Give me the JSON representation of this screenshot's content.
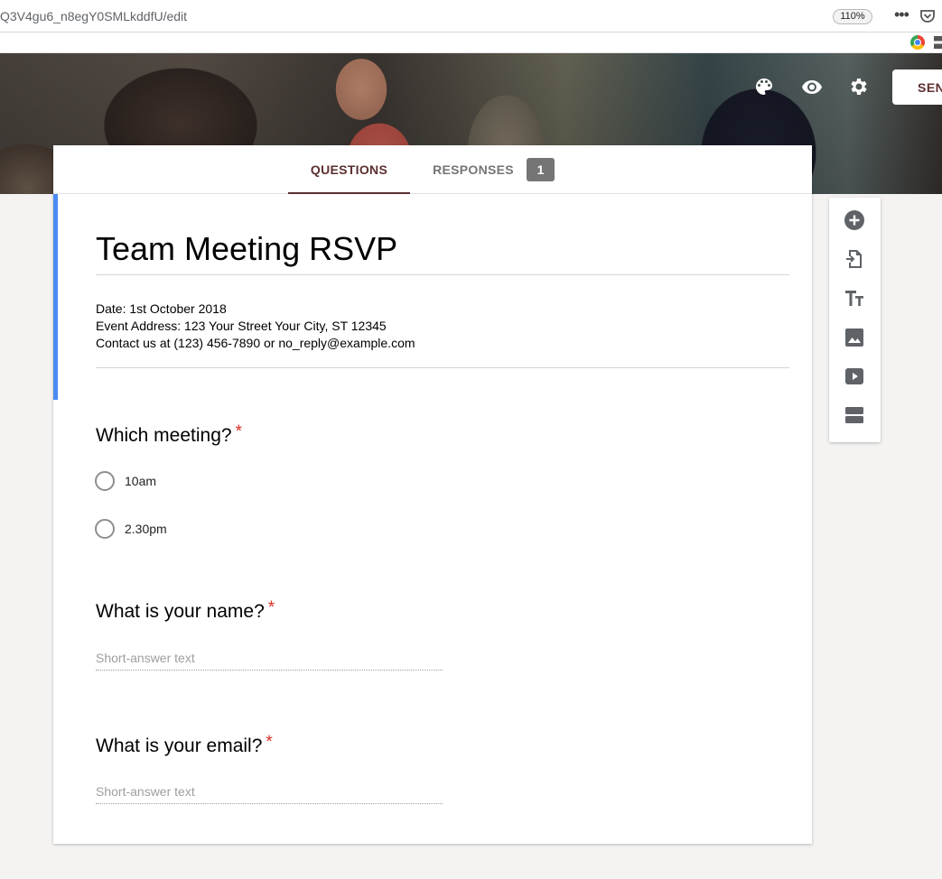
{
  "browser": {
    "url": "Q3V4gu6_n8egY0SMLkddfU/edit",
    "zoom": "110%"
  },
  "header": {
    "send_label": "SEN",
    "icons": [
      "palette-icon",
      "preview-eye-icon",
      "settings-gear-icon"
    ]
  },
  "tabs": {
    "questions": "QUESTIONS",
    "responses": "RESPONSES",
    "responses_count": "1"
  },
  "form": {
    "title": "Team Meeting RSVP",
    "description": [
      "Date: 1st October 2018",
      "Event Address: 123 Your Street Your City, ST 12345",
      "Contact us at (123) 456-7890 or no_reply@example.com"
    ]
  },
  "questions": [
    {
      "title": "Which meeting?",
      "required": "*",
      "type": "radio",
      "options": [
        "10am",
        "2.30pm"
      ]
    },
    {
      "title": "What is your name?",
      "required": "*",
      "type": "short",
      "placeholder": "Short-answer text"
    },
    {
      "title": "What is your email?",
      "required": "*",
      "type": "short",
      "placeholder": "Short-answer text"
    }
  ],
  "toolbar": {
    "items": [
      "add-question-icon",
      "import-questions-icon",
      "add-title-icon",
      "add-image-icon",
      "add-video-icon",
      "add-section-icon"
    ]
  },
  "colors": {
    "accent": "#5d2f2f",
    "title_border": "#4a8af4",
    "required": "#d93025",
    "background": "#f4f3f1"
  }
}
